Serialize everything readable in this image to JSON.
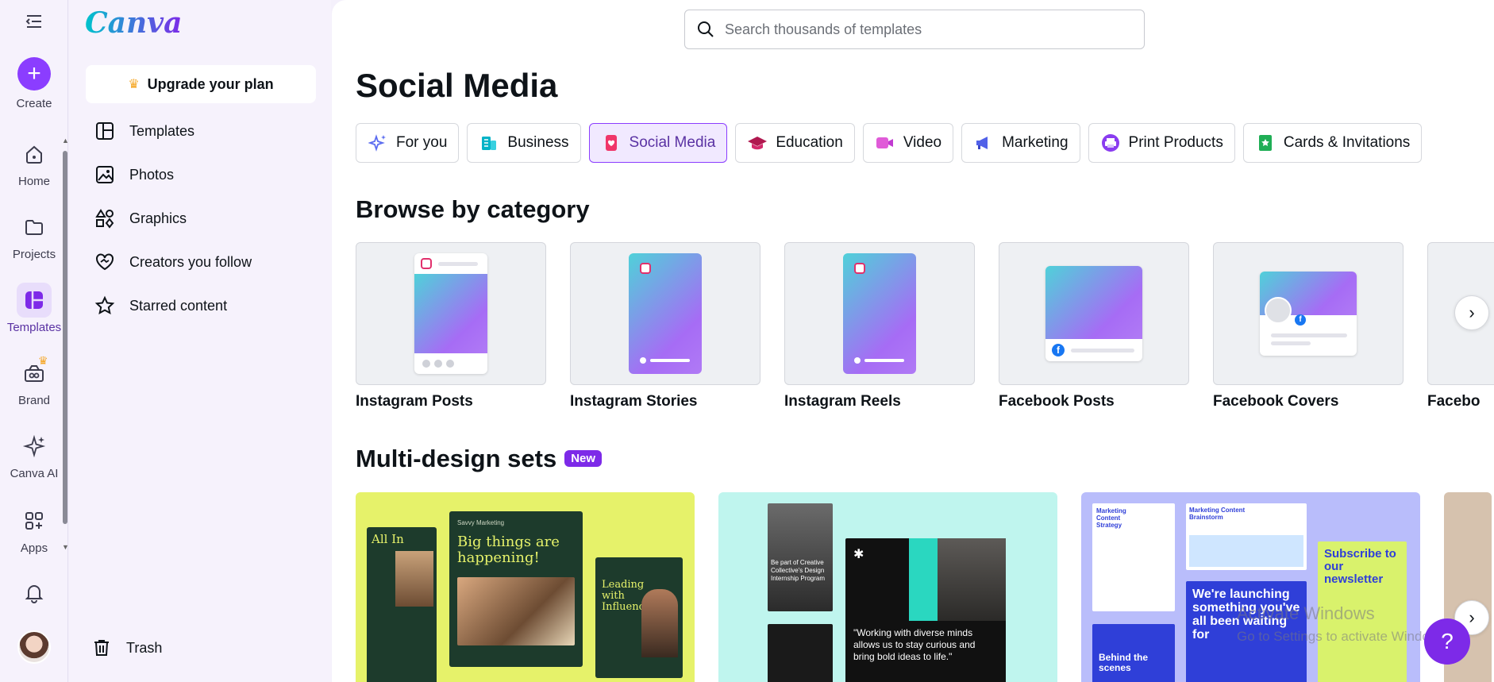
{
  "brand": {
    "logo_text": "Canva"
  },
  "rail": {
    "create": "Create",
    "items": [
      {
        "label": "Home"
      },
      {
        "label": "Projects"
      },
      {
        "label": "Templates"
      },
      {
        "label": "Brand"
      },
      {
        "label": "Canva AI"
      },
      {
        "label": "Apps"
      }
    ]
  },
  "sidebar": {
    "upgrade": "Upgrade your plan",
    "items": [
      {
        "label": "Templates"
      },
      {
        "label": "Photos"
      },
      {
        "label": "Graphics"
      },
      {
        "label": "Creators you follow"
      },
      {
        "label": "Starred content"
      }
    ],
    "trash": "Trash"
  },
  "search": {
    "placeholder": "Search thousands of templates"
  },
  "page": {
    "title": "Social Media"
  },
  "categories": [
    {
      "label": "For you"
    },
    {
      "label": "Business"
    },
    {
      "label": "Social Media",
      "active": true
    },
    {
      "label": "Education"
    },
    {
      "label": "Video"
    },
    {
      "label": "Marketing"
    },
    {
      "label": "Print Products"
    },
    {
      "label": "Cards & Invitations"
    }
  ],
  "browse": {
    "heading": "Browse by category",
    "cards": [
      {
        "label": "Instagram Posts"
      },
      {
        "label": "Instagram Stories"
      },
      {
        "label": "Instagram Reels"
      },
      {
        "label": "Facebook Posts"
      },
      {
        "label": "Facebook Covers"
      },
      {
        "label": "Facebo"
      }
    ]
  },
  "sets": {
    "heading": "Multi-design sets",
    "badge": "New",
    "set1": {
      "t1": "All In",
      "t2": "Big things are happening!",
      "t3": "Leading with Influence",
      "brand": "Savvy Marketing"
    },
    "set2": {
      "quote": "\"Working with diverse minds allows us to stay curious and bring bold ideas to life.\"",
      "cap": "Be part of Creative Collective's Design Internship Program"
    },
    "set3": {
      "a": "Marketing Content Strategy",
      "b": "Marketing Content Brainstorm",
      "c": "Subscribe to our newsletter",
      "d": "We're launching something you've all been waiting for",
      "e": "Behind the scenes"
    }
  },
  "overlay": {
    "watermark1": "Activate Windows",
    "watermark2": "Go to Settings to activate Windows.",
    "help": "?"
  },
  "colors": {
    "accent": "#8b3dff",
    "brand_purple": "#7d2ae8"
  }
}
